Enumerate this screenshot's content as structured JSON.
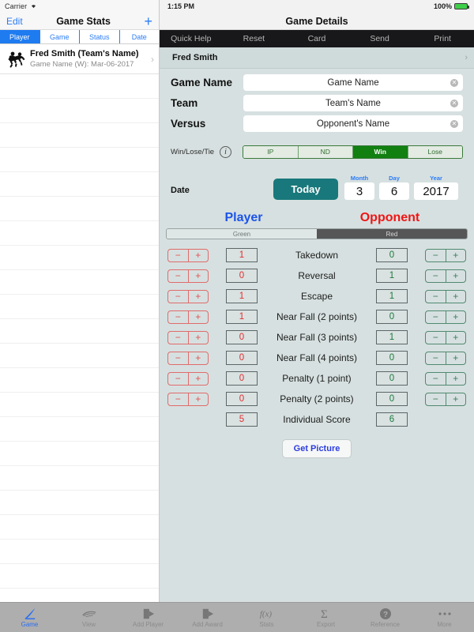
{
  "left": {
    "status": {
      "carrier": "Carrier",
      "wifi_icon": "wifi-icon"
    },
    "navbar": {
      "edit_label": "Edit",
      "title": "Game Stats",
      "add_label": "+"
    },
    "tabs": [
      {
        "label": "Player",
        "active": true
      },
      {
        "label": "Game",
        "active": false
      },
      {
        "label": "Status",
        "active": false
      },
      {
        "label": "Date",
        "active": false
      }
    ],
    "list": {
      "first_item": {
        "icon": "wrestlers-icon",
        "title": "Fred Smith (Team's Name)",
        "subtitle": "Game Name (W): Mar-06-2017",
        "chevron": "›"
      },
      "empty_row_count": 21
    }
  },
  "right": {
    "status": {
      "time": "1:15 PM",
      "battery_percent": "100%"
    },
    "navbar": {
      "title": "Game Details"
    },
    "toolbar": [
      {
        "label": "Quick Help"
      },
      {
        "label": "Reset"
      },
      {
        "label": "Card"
      },
      {
        "label": "Send"
      },
      {
        "label": "Print"
      }
    ],
    "person": {
      "name": "Fred Smith",
      "chevron": "›"
    },
    "form": [
      {
        "label": "Game Name",
        "value": "Game Name"
      },
      {
        "label": "Team",
        "value": "Team's Name"
      },
      {
        "label": "Versus",
        "value": "Opponent's Name"
      }
    ],
    "winlose": {
      "label": "Win/Lose/Tie",
      "info_icon": "info-icon",
      "options": [
        {
          "label": "IP",
          "active": false
        },
        {
          "label": "ND",
          "active": false
        },
        {
          "label": "Win",
          "active": true
        },
        {
          "label": "Lose",
          "active": false
        }
      ]
    },
    "date": {
      "label": "Date",
      "today_label": "Today",
      "month_label": "Month",
      "month_value": "3",
      "day_label": "Day",
      "day_value": "6",
      "year_label": "Year",
      "year_value": "2017"
    },
    "sides": {
      "player_label": "Player",
      "opponent_label": "Opponent"
    },
    "color_seg": [
      {
        "label": "Green",
        "selected": false
      },
      {
        "label": "Red",
        "selected": true
      }
    ],
    "stepper": {
      "minus": "−",
      "plus": "+"
    },
    "scores": [
      {
        "label": "Takedown",
        "player": "1",
        "opponent": "0",
        "steppers": true
      },
      {
        "label": "Reversal",
        "player": "0",
        "opponent": "1",
        "steppers": true
      },
      {
        "label": "Escape",
        "player": "1",
        "opponent": "1",
        "steppers": true
      },
      {
        "label": "Near Fall (2 points)",
        "player": "1",
        "opponent": "0",
        "steppers": true
      },
      {
        "label": "Near Fall (3 points)",
        "player": "0",
        "opponent": "1",
        "steppers": true
      },
      {
        "label": "Near Fall (4 points)",
        "player": "0",
        "opponent": "0",
        "steppers": true
      },
      {
        "label": "Penalty (1 point)",
        "player": "0",
        "opponent": "0",
        "steppers": true
      },
      {
        "label": "Penalty (2 points)",
        "player": "0",
        "opponent": "0",
        "steppers": true
      },
      {
        "label": "Individual Score",
        "player": "5",
        "opponent": "6",
        "steppers": false
      }
    ],
    "get_picture_label": "Get Picture"
  },
  "tabbar": [
    {
      "label": "Game",
      "icon": "pen-icon",
      "active": true
    },
    {
      "label": "View",
      "icon": "eye-icon",
      "active": false
    },
    {
      "label": "Add Player",
      "icon": "add-player-icon",
      "active": false
    },
    {
      "label": "Add Award",
      "icon": "add-award-icon",
      "active": false
    },
    {
      "label": "Stats",
      "icon": "function-icon",
      "active": false
    },
    {
      "label": "Export",
      "icon": "sigma-icon",
      "active": false
    },
    {
      "label": "Reference",
      "icon": "question-icon",
      "active": false
    },
    {
      "label": "More",
      "icon": "ellipsis-icon",
      "active": false
    }
  ],
  "colors": {
    "accent_blue": "#2b7cf6",
    "player_blue": "#1b54e8",
    "opponent_red": "#f01515",
    "win_green": "#118011",
    "today_teal": "#19787b",
    "panel_bg": "#d7e0e0"
  }
}
